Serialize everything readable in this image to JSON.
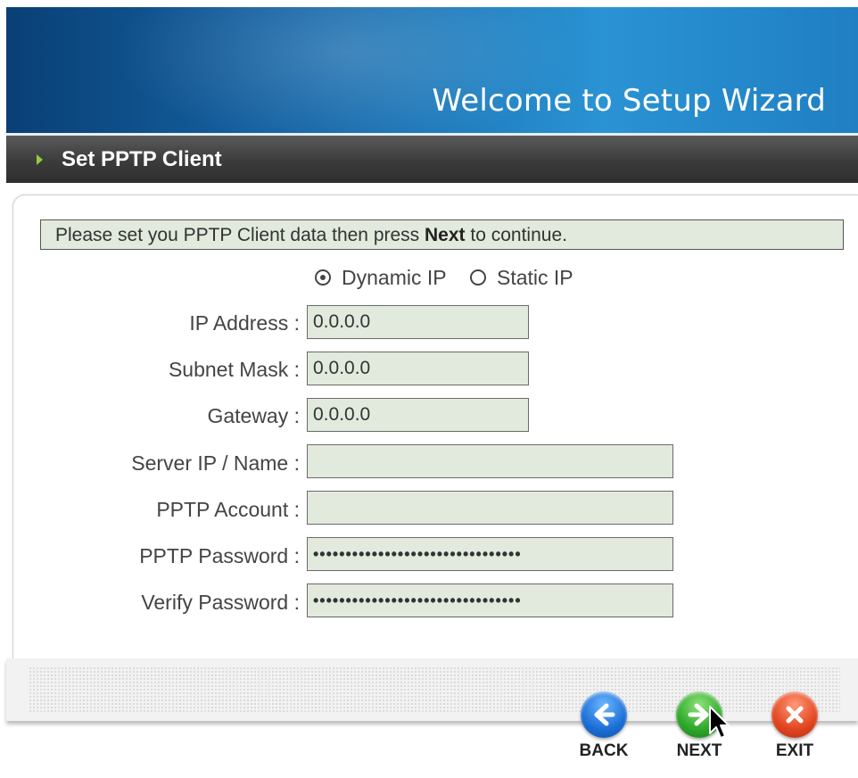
{
  "header": {
    "title": "Welcome to Setup Wizard",
    "brand_color": "#1f7fc2"
  },
  "section": {
    "title": "Set PPTP Client"
  },
  "notice": {
    "text_before": "Please set you PPTP Client data then press ",
    "bold": "Next",
    "text_after": " to continue."
  },
  "ip_mode": {
    "options": [
      "Dynamic IP",
      "Static IP"
    ],
    "selected": "Dynamic IP"
  },
  "form": {
    "ip_address": {
      "label": "IP Address :",
      "value": "0.0.0.0"
    },
    "subnet_mask": {
      "label": "Subnet Mask :",
      "value": "0.0.0.0"
    },
    "gateway": {
      "label": "Gateway :",
      "value": "0.0.0.0"
    },
    "server_ip": {
      "label": "Server IP / Name :",
      "value": ""
    },
    "pptp_account": {
      "label": "PPTP Account :",
      "value": ""
    },
    "pptp_password": {
      "label": "PPTP Password :",
      "value": "••••••••••••••••••••••••••••••••"
    },
    "verify_password": {
      "label": "Verify Password :",
      "value": "••••••••••••••••••••••••••••••••"
    }
  },
  "nav": {
    "back": "BACK",
    "next": "NEXT",
    "exit": "EXIT"
  }
}
